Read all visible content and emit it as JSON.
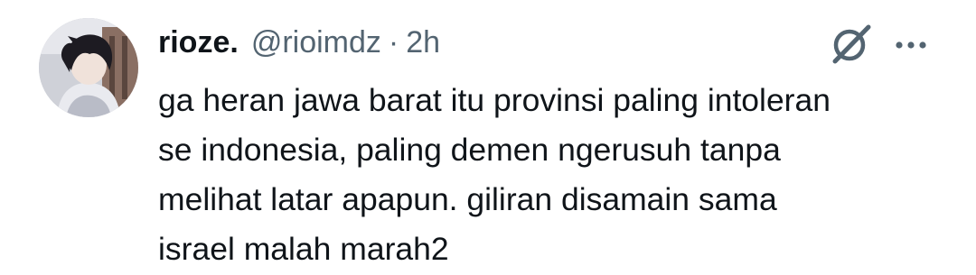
{
  "tweet": {
    "author": {
      "display_name": "rioze.",
      "handle": "@rioimdz",
      "avatar_icon": "user-avatar"
    },
    "separator": "·",
    "time": "2h",
    "body_lines": [
      "ga heran jawa barat itu provinsi paling intoleran",
      "se indonesia, paling demen ngerusuh tanpa",
      "melihat latar apapun. giliran disamain sama",
      "israel malah marah2"
    ],
    "actions": {
      "grok_icon": "grok-icon",
      "more_icon": "more-horizontal-icon"
    }
  },
  "colors": {
    "text_primary": "#0f1419",
    "text_secondary": "#536471",
    "background": "#ffffff"
  }
}
